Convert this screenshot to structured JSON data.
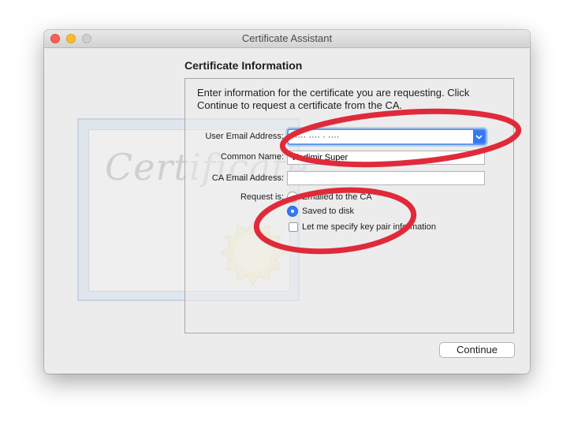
{
  "window": {
    "title": "Certificate Assistant"
  },
  "background": {
    "certificate_word": "Certificate"
  },
  "heading": "Certificate Information",
  "intro": "Enter information for the certificate you are requesting. Click Continue to request a certificate from the CA.",
  "form": {
    "user_email_label": "User Email Address:",
    "user_email_value": "·····  ····  ·  ····",
    "common_name_label": "Common Name:",
    "common_name_value": "Vladimir Super",
    "ca_email_label": "CA Email Address:",
    "ca_email_value": "",
    "request_label": "Request is:",
    "options": {
      "emailed": {
        "label": "Emailed to the CA",
        "selected": false
      },
      "saved": {
        "label": "Saved to disk",
        "selected": true
      }
    },
    "keypair_label": "Let me specify key pair information",
    "keypair_checked": false
  },
  "buttons": {
    "continue": "Continue"
  },
  "colors": {
    "annotation": "#e02a3a",
    "accent": "#3478f6"
  },
  "icons": {
    "dropdown": "chevron-down-icon",
    "seal": "seal-icon"
  }
}
